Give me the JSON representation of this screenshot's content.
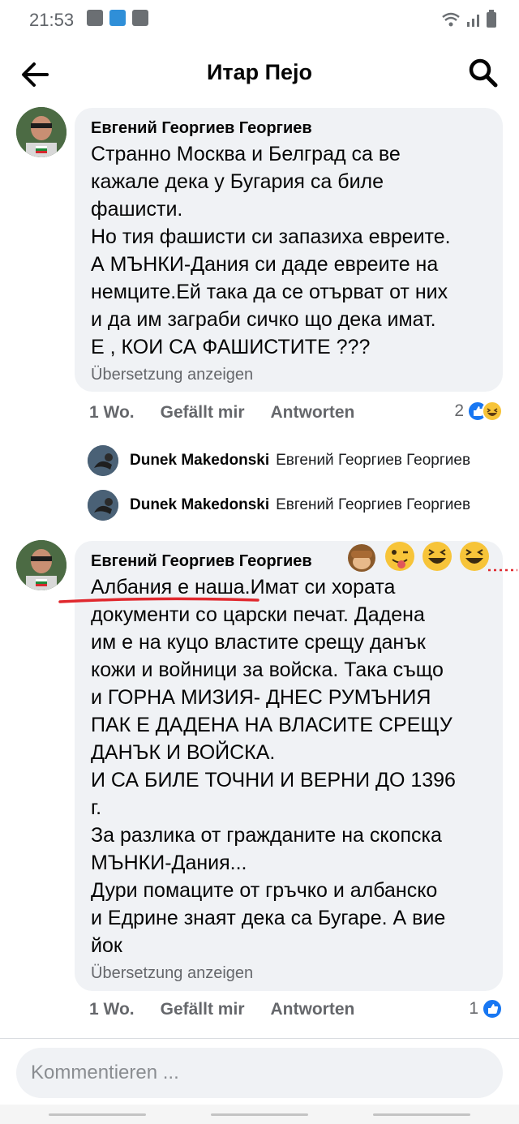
{
  "status_bar": {
    "time": "21:53"
  },
  "header": {
    "title": "Итар Пејо",
    "back_icon": "arrow-left-icon",
    "search_icon": "search-icon"
  },
  "comments": [
    {
      "author": "Евгений Георгиев Георгиев",
      "text": "Странно Москва и Белград  са ве\nкажале дека у Бугария са биле\nфашисти.\nНо тия фашисти си запазиха евреите.\nА МЪНКИ-Дания си даде евреите на\nнемците.Ей така да се отърват от них\nи да им заграби сичко що дека имат.\nЕ , КОИ СА ФАШИСТИТЕ  ???",
      "translate": "Übersetzung anzeigen",
      "time": "1 Wo.",
      "like": "Gefällt mir",
      "reply": "Antworten",
      "reaction_count": "2"
    },
    {
      "author": "Евгений Георгиев Георгиев",
      "text": "Албания е наша.Имат си хората\nдокументи  со царски печат. Дадена\nим  е на куцо властите срещу  данък\nкожи и войници за войска. Така също\nи ГОРНА МИЗИЯ- ДНЕС РУМЪНИЯ\nПАК Е ДАДЕНА НА ВЛАСИТЕ СРЕЩУ\nДАНЪК И ВОЙСКА.\nИ СА БИЛЕ ТОЧНИ И ВЕРНИ ДО 1396\nг.\nЗа разлика от  гражданите на скопска\nМЪНКИ-Дания...\nДури помаците от гръчко и албанско\nи Едрине знаят дека са Бугаре. А вие\nйок",
      "translate": "Übersetzung anzeigen",
      "time": "1 Wo.",
      "like": "Gefällt mir",
      "reply": "Antworten",
      "reaction_count": "1"
    }
  ],
  "replies": [
    {
      "name": "Dunek Makedonski",
      "preview": "Евгений Георгиев Георгиев"
    },
    {
      "name": "Dunek Makedonski",
      "preview": "Евгений Георгиев Георгиев"
    }
  ],
  "composer": {
    "placeholder": "Kommentieren ..."
  },
  "colors": {
    "accent": "#1877f2",
    "bubble": "#f0f2f5",
    "underline": "#e0282e"
  }
}
